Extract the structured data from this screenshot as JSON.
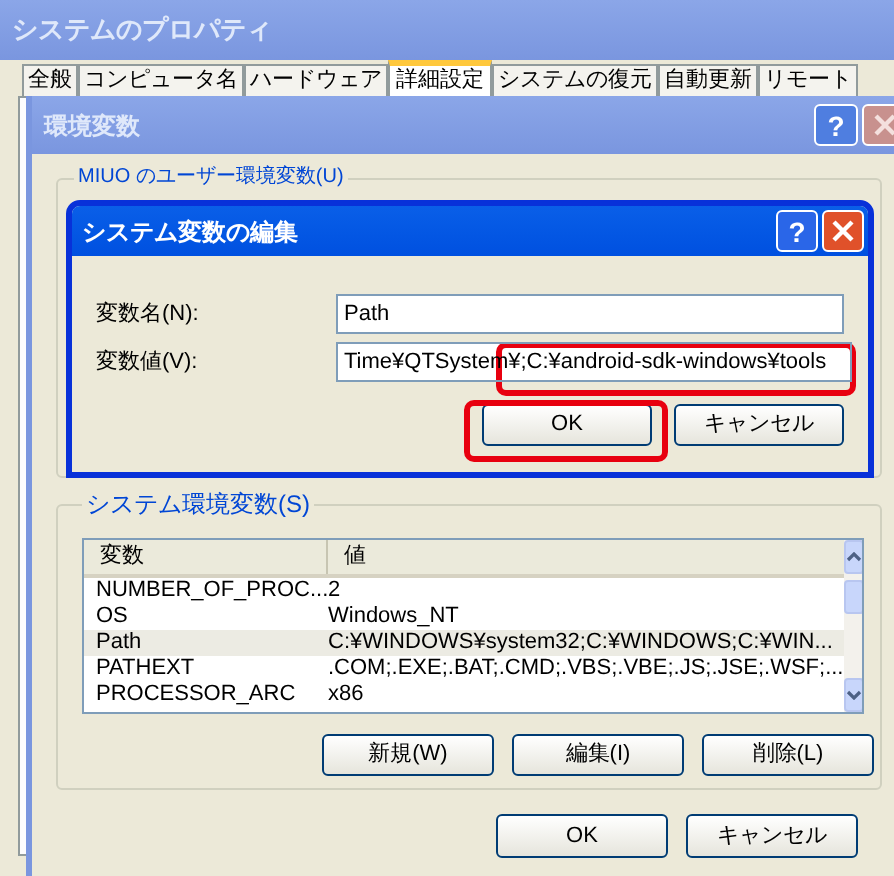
{
  "system_properties": {
    "title": "システムのプロパティ",
    "tabs": [
      {
        "label": "全般",
        "selected": false
      },
      {
        "label": "コンピュータ名",
        "selected": false
      },
      {
        "label": "ハードウェア",
        "selected": false
      },
      {
        "label": "詳細設定",
        "selected": true
      },
      {
        "label": "システムの復元",
        "selected": false
      },
      {
        "label": "自動更新",
        "selected": false
      },
      {
        "label": "リモート",
        "selected": false
      }
    ]
  },
  "env_window": {
    "title": "環境変数",
    "help_button": "?",
    "user_group_label": "MIUO のユーザー環境変数(U)",
    "system_group": {
      "label": "システム環境変数(S)",
      "columns": [
        "変数",
        "値"
      ],
      "rows": [
        {
          "name": "NUMBER_OF_PROC...",
          "value": "2",
          "selected": false
        },
        {
          "name": "OS",
          "value": "Windows_NT",
          "selected": false
        },
        {
          "name": "Path",
          "value": "C:¥WINDOWS¥system32;C:¥WINDOWS;C:¥WIN...",
          "selected": true
        },
        {
          "name": "PATHEXT",
          "value": ".COM;.EXE;.BAT;.CMD;.VBS;.VBE;.JS;.JSE;.WSF;...",
          "selected": false
        },
        {
          "name": "PROCESSOR_ARC",
          "value": "x86",
          "selected": false
        }
      ],
      "buttons": [
        "新規(W)",
        "編集(I)",
        "削除(L)"
      ]
    },
    "buttons": [
      "OK",
      "キャンセル"
    ]
  },
  "edit_dialog": {
    "title": "システム変数の編集",
    "help_button": "?",
    "fields": [
      {
        "label": "変数名(N):",
        "value": "Path",
        "highlighted": false
      },
      {
        "label": "変数値(V):",
        "value": "Time¥QTSystem¥;C:¥android-sdk-windows¥tools",
        "highlighted": true
      }
    ],
    "buttons": [
      {
        "label": "OK",
        "highlighted": true
      },
      {
        "label": "キャンセル",
        "highlighted": false
      }
    ]
  }
}
